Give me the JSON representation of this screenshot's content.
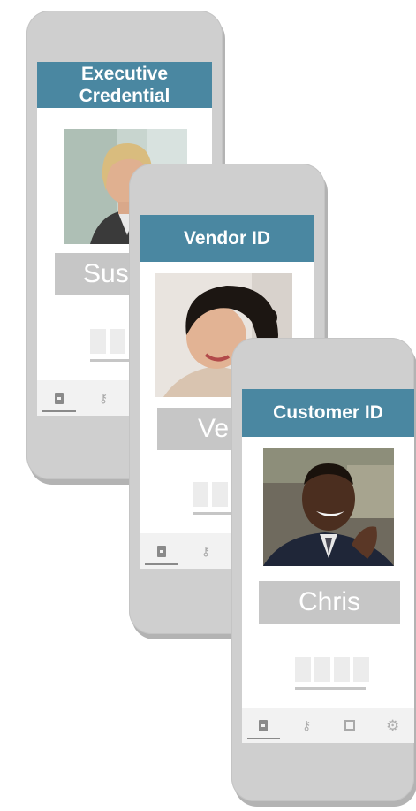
{
  "cards": [
    {
      "title": "Executive\nCredential",
      "name": "Susan",
      "photo_icon": "woman-blonde-portrait",
      "tabs": [
        "id-card-icon",
        "key-icon"
      ]
    },
    {
      "title": "Vendor ID",
      "name": "Vera",
      "photo_icon": "woman-dark-hair-portrait",
      "tabs": [
        "id-card-icon",
        "key-icon"
      ]
    },
    {
      "title": "Customer ID",
      "name": "Chris",
      "photo_icon": "man-smiling-portrait",
      "tabs": [
        "id-card-icon",
        "key-icon",
        "scan-icon",
        "gear-icon"
      ]
    }
  ],
  "colors": {
    "title_bar": "#4a87a1",
    "name_box": "#c6c6c6",
    "phone": "#cfcfcf"
  }
}
